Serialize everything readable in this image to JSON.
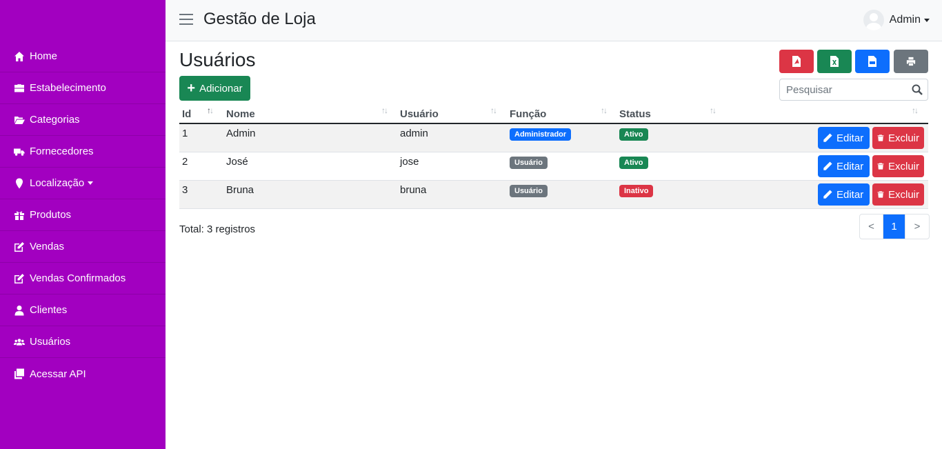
{
  "app": {
    "title": "Gestão de Loja"
  },
  "user": {
    "name": "Admin"
  },
  "sidebar": {
    "items": [
      {
        "label": "Home",
        "icon": "home-icon"
      },
      {
        "label": "Estabelecimento",
        "icon": "briefcase-icon"
      },
      {
        "label": "Categorias",
        "icon": "folder-open-icon"
      },
      {
        "label": "Fornecedores",
        "icon": "truck-icon"
      },
      {
        "label": "Localização",
        "icon": "map-marker-icon"
      },
      {
        "label": "Produtos",
        "icon": "gift-icon"
      },
      {
        "label": "Vendas",
        "icon": "edit-icon"
      },
      {
        "label": "Vendas Confirmados",
        "icon": "edit-icon"
      },
      {
        "label": "Clientes",
        "icon": "user-icon"
      },
      {
        "label": "Usuários",
        "icon": "users-icon"
      },
      {
        "label": "Acessar API",
        "icon": "copy-icon"
      }
    ]
  },
  "page": {
    "title": "Usuários",
    "add_label": "Adicionar"
  },
  "search": {
    "placeholder": "Pesquisar",
    "value": ""
  },
  "table": {
    "columns": [
      "Id",
      "Nome",
      "Usuário",
      "Função",
      "Status"
    ],
    "rows": [
      {
        "id": "1",
        "nome": "Admin",
        "usuario": "admin",
        "funcao": "Administrador",
        "status": "Ativo"
      },
      {
        "id": "2",
        "nome": "José",
        "usuario": "jose",
        "funcao": "Usuário",
        "status": "Ativo"
      },
      {
        "id": "3",
        "nome": "Bruna",
        "usuario": "bruna",
        "funcao": "Usuário",
        "status": "Inativo"
      }
    ],
    "edit_label": "Editar",
    "delete_label": "Excluir"
  },
  "footer": {
    "total": "Total: 3 registros"
  },
  "pagination": {
    "prev": "<",
    "current": "1",
    "next": ">"
  },
  "colors": {
    "sidebar": "#a200c0",
    "primary": "#0d6efd",
    "success": "#198754",
    "danger": "#dc3545",
    "secondary": "#6c757d"
  }
}
